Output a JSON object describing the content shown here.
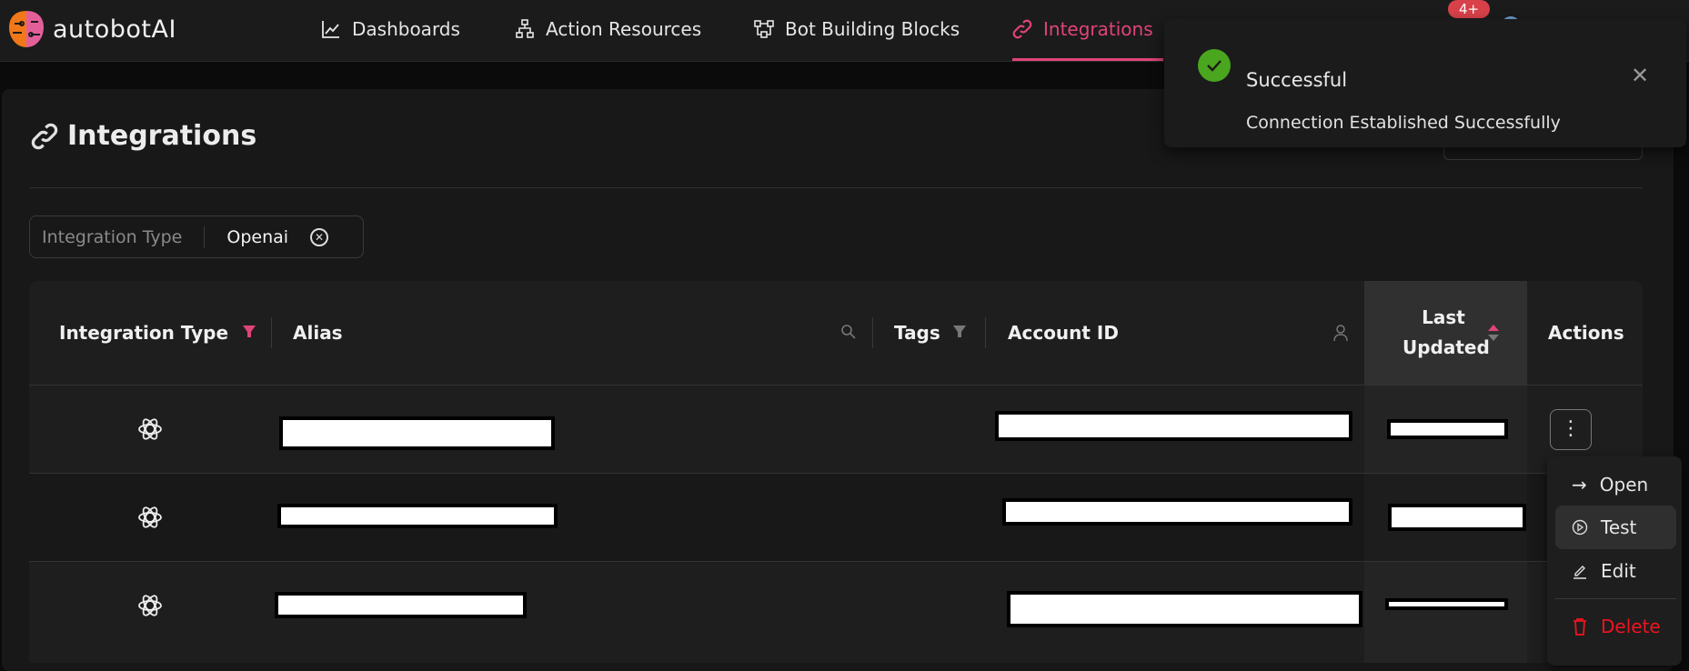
{
  "app": {
    "logo_text": "autobotAI",
    "notification_count": "4+"
  },
  "nav": {
    "items": [
      {
        "label": "Dashboards",
        "icon": "chart-line-icon"
      },
      {
        "label": "Action Resources",
        "icon": "sitemap-icon"
      },
      {
        "label": "Bot Building Blocks",
        "icon": "blocks-icon"
      },
      {
        "label": "Integrations",
        "icon": "link-icon",
        "active": true
      }
    ]
  },
  "page": {
    "title": "Integrations"
  },
  "filter": {
    "label": "Integration Type",
    "value": "Openai"
  },
  "table": {
    "columns": [
      "Integration Type",
      "Alias",
      "Tags",
      "Account ID",
      "Last Updated",
      "Actions"
    ],
    "sorted_column": "Last Updated",
    "rows": [
      {
        "type": "openai"
      },
      {
        "type": "openai"
      },
      {
        "type": "openai"
      }
    ]
  },
  "row_menu": {
    "items": [
      "Open",
      "Test",
      "Edit",
      "Delete"
    ],
    "highlighted": "Test"
  },
  "toast": {
    "title": "Successful",
    "message": "Connection Established Successfully",
    "status": "success"
  },
  "colors": {
    "accent": "#e0437a",
    "success": "#4aa61e",
    "danger": "#f0141e"
  }
}
